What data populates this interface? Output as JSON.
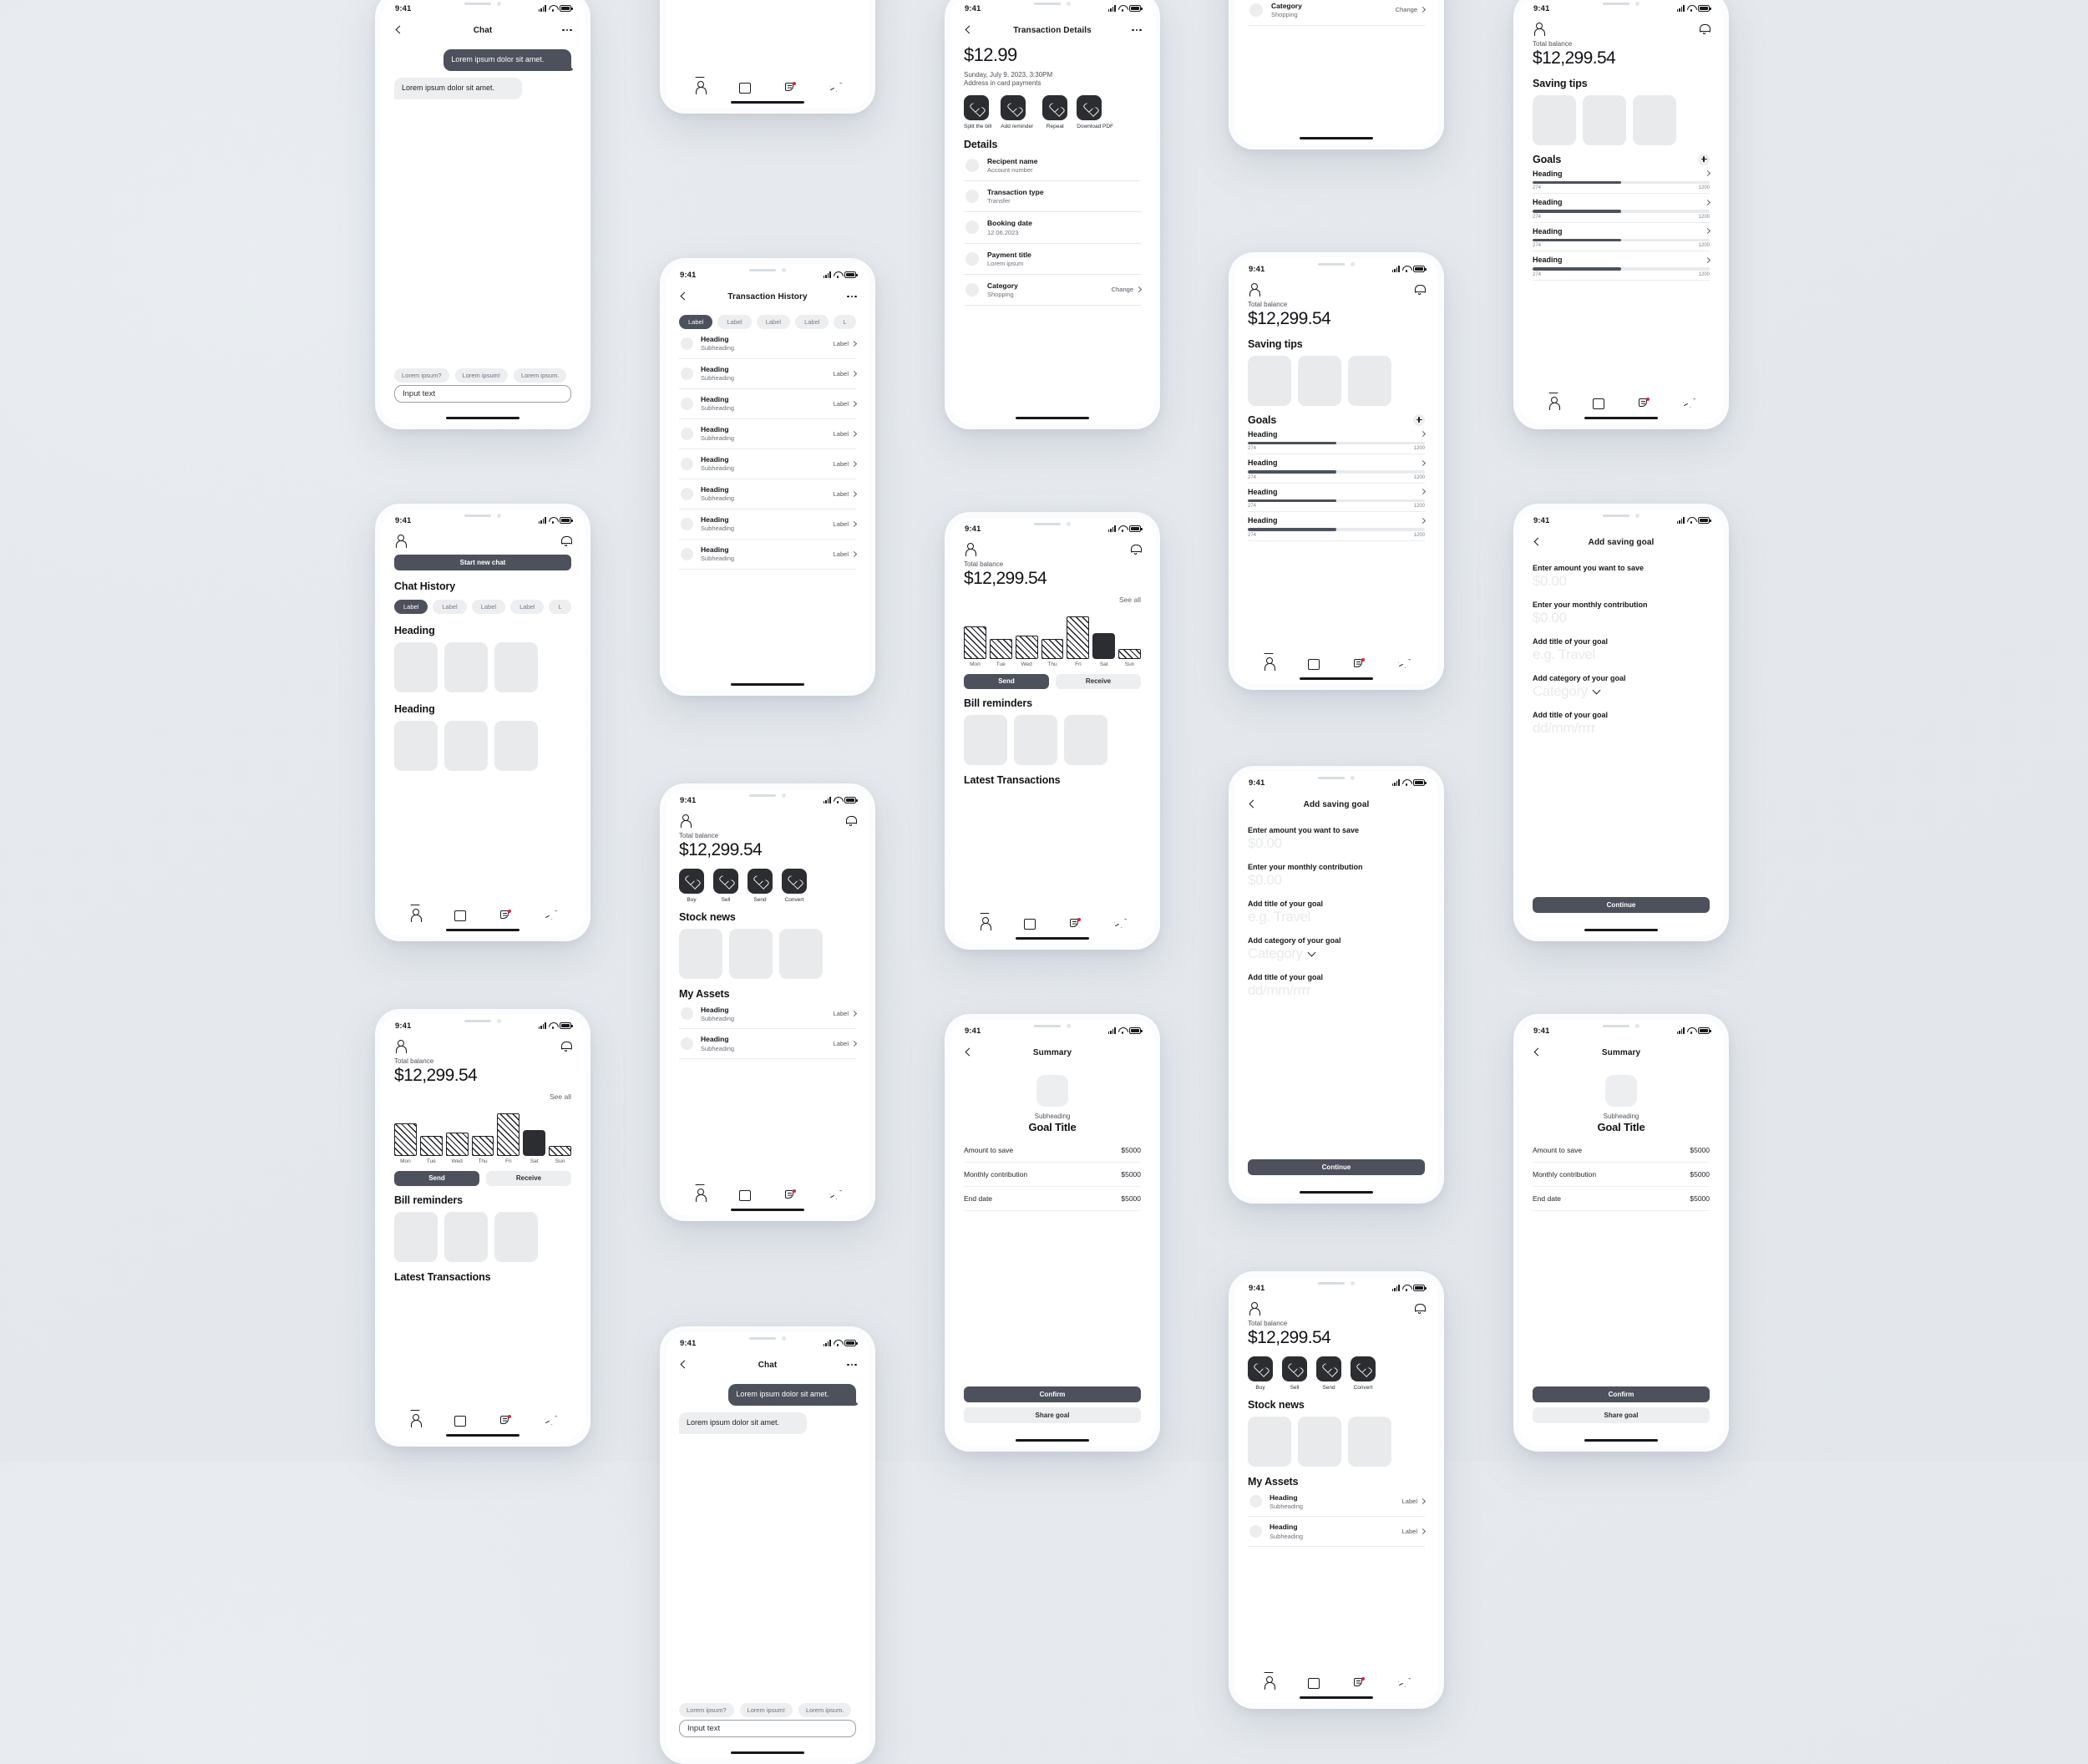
{
  "meta": {
    "status_time": "9:41",
    "accent_dark": "#4c515b",
    "accent_button": "#2b2d31",
    "badge_red": "#d7263d",
    "placeholder_grey": "#e8eaec",
    "page_background": "#e6e9ec"
  },
  "common": {
    "total_balance_label": "Total balance",
    "balance_value": "$12,299.54",
    "see_all": "See all",
    "heading": "Heading",
    "subheading": "Subheading",
    "label": "Label",
    "chevron": "›"
  },
  "icons": {
    "back": "chevron-left-icon",
    "more": "more-options-icon",
    "profile": "person-icon",
    "bell": "notification-bell-icon",
    "heart": "heart-icon",
    "plus": "plus-icon",
    "tab_profile": "person-icon",
    "tab_book": "book-icon",
    "tab_notes": "notes-icon",
    "tab_send": "paper-plane-icon"
  },
  "chart_data": {
    "type": "bar",
    "title": "Weekly spending",
    "categories": [
      "Mon",
      "Tue",
      "Wed",
      "Thu",
      "Fri",
      "Sat",
      "Sun"
    ],
    "values": [
      62,
      38,
      45,
      38,
      82,
      50,
      18
    ],
    "highlight_index": 5,
    "xlabel": "",
    "ylabel": "",
    "ylim": [
      0,
      100
    ],
    "grid": false,
    "legend": false,
    "note": "Hatched outline bars; Saturday rendered as solid filled bar"
  },
  "screens": {
    "chat": {
      "title": "Chat",
      "messages": [
        {
          "side": "out",
          "text": "Lorem ipsum dolor sit amet."
        },
        {
          "side": "in",
          "text": "Lorem ipsum dolor sit amet."
        }
      ],
      "quick_replies": [
        "Lorem ipsum?",
        "Lorem ipsum!",
        "Lorem ipsum."
      ],
      "input_value": "Input text"
    },
    "transaction_details": {
      "title": "Transaction Details",
      "amount": "$12.99",
      "datetime": "Sunday, July 9, 2023, 3:30PM",
      "address": "Address in card payments",
      "actions": [
        "Split the bill",
        "Add reminder",
        "Repeat",
        "Download PDF"
      ],
      "details_title": "Details",
      "rows": [
        {
          "heading": "Recipent name",
          "sub": "Account number",
          "action": ""
        },
        {
          "heading": "Transaction type",
          "sub": "Transfer",
          "action": ""
        },
        {
          "heading": "Booking date",
          "sub": "12.06.2023",
          "action": ""
        },
        {
          "heading": "Payment title",
          "sub": "Lorem ipsum",
          "action": ""
        },
        {
          "heading": "Category",
          "sub": "Shopping",
          "action": "Change"
        }
      ]
    },
    "transaction_history": {
      "title": "Transaction History",
      "filters": [
        "Label",
        "Label",
        "Label",
        "Label",
        "L"
      ],
      "rows_count": 8
    },
    "chat_history": {
      "new_chat_button": "Start new chat",
      "title": "Chat History",
      "filters": [
        "Label",
        "Label",
        "Label",
        "Label",
        "L"
      ],
      "sections": [
        "Heading",
        "Heading"
      ]
    },
    "dashboard": {
      "see_all": "See all",
      "send_button": "Send",
      "receive_button": "Receive",
      "bill_reminders_title": "Bill reminders",
      "latest_transactions_title": "Latest Transactions"
    },
    "stocks": {
      "actions": [
        "Buy",
        "Sell",
        "Send",
        "Convert"
      ],
      "stock_news_title": "Stock news",
      "my_assets_title": "My Assets"
    },
    "goals": {
      "saving_tips_title": "Saving tips",
      "goals_title": "Goals",
      "items": [
        {
          "heading": "Heading",
          "current": "274",
          "target": "1200",
          "percent": 50
        },
        {
          "heading": "Heading",
          "current": "274",
          "target": "1200",
          "percent": 50
        },
        {
          "heading": "Heading",
          "current": "274",
          "target": "1200",
          "percent": 50
        },
        {
          "heading": "Heading",
          "current": "274",
          "target": "1200",
          "percent": 50
        }
      ]
    },
    "add_goal": {
      "title": "Add saving goal",
      "fields": [
        {
          "label": "Enter amount you want to save",
          "placeholder": "$0.00",
          "type": "text"
        },
        {
          "label": "Enter your monthly contribution",
          "placeholder": "$0.00",
          "type": "text"
        },
        {
          "label": "Add title of your goal",
          "placeholder": "e.g. Travel",
          "type": "text"
        },
        {
          "label": "Add category of your goal",
          "placeholder": "Category",
          "type": "select"
        },
        {
          "label": "Add title of your goal",
          "placeholder": "dd/mm/rrrr",
          "type": "date"
        }
      ],
      "continue_button": "Continue"
    },
    "summary": {
      "title": "Summary",
      "subheading": "Subheading",
      "goal_title": "Goal Title",
      "rows": [
        {
          "label": "Amount to save",
          "value": "$5000"
        },
        {
          "label": "Monthly contribution",
          "value": "$5000"
        },
        {
          "label": "End date",
          "value": "$5000"
        }
      ],
      "confirm_button": "Confirm",
      "share_button": "Share goal"
    }
  }
}
